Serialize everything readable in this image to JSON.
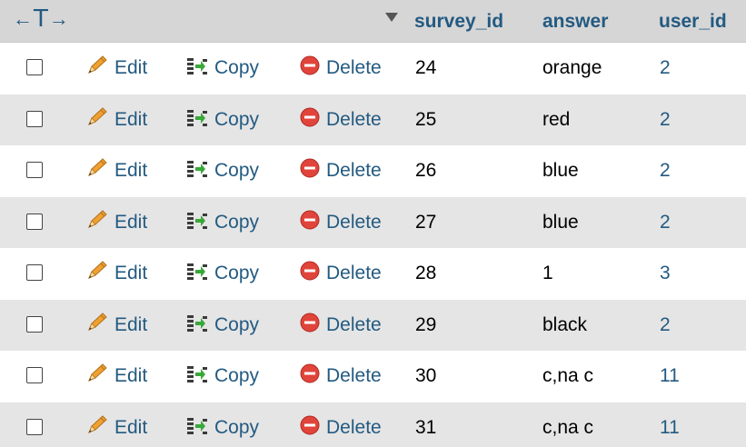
{
  "header": {
    "arrow_left": "←",
    "t_glyph": "T",
    "arrow_right": "→",
    "columns": [
      "survey_id",
      "answer",
      "user_id"
    ]
  },
  "actions": {
    "edit_label": "Edit",
    "copy_label": "Copy",
    "delete_label": "Delete"
  },
  "rows": [
    {
      "survey_id": "24",
      "answer": "orange",
      "user_id": "2"
    },
    {
      "survey_id": "25",
      "answer": "red",
      "user_id": "2"
    },
    {
      "survey_id": "26",
      "answer": "blue",
      "user_id": "2"
    },
    {
      "survey_id": "27",
      "answer": "blue",
      "user_id": "2"
    },
    {
      "survey_id": "28",
      "answer": "1",
      "user_id": "3"
    },
    {
      "survey_id": "29",
      "answer": "black",
      "user_id": "2"
    },
    {
      "survey_id": "30",
      "answer": "c,na c",
      "user_id": "11"
    },
    {
      "survey_id": "31",
      "answer": "c,na c",
      "user_id": "11"
    }
  ],
  "colors": {
    "link": "#235a81",
    "header_bg": "#d6d6d6",
    "row_alt_bg": "#e5e5e5",
    "delete_red": "#e0443a",
    "pencil_orange": "#f0a030"
  }
}
